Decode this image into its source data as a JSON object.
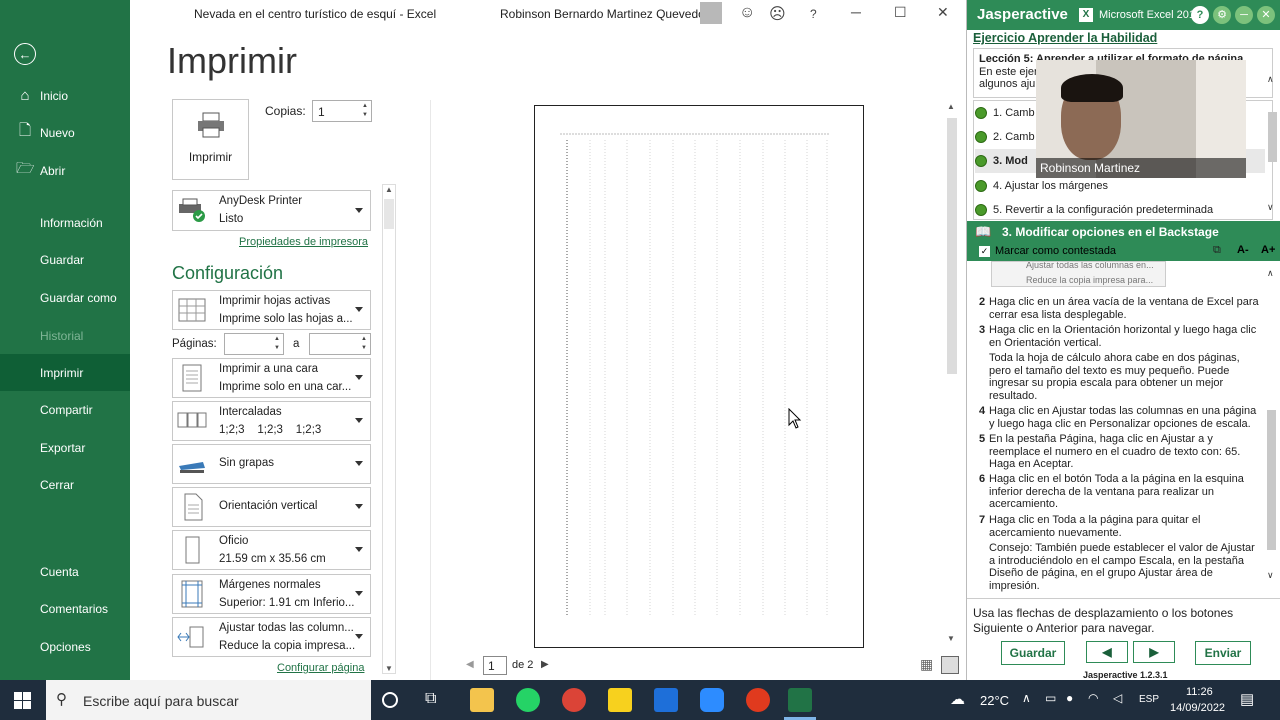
{
  "window": {
    "title": "Nevada en el centro turístico de esquí  -  Excel",
    "user": "Robinson Bernardo Martinez Quevedo",
    "help": "?"
  },
  "nav": {
    "items": [
      {
        "label": "Inicio",
        "icon": "home-icon"
      },
      {
        "label": "Nuevo",
        "icon": "new-file-icon"
      },
      {
        "label": "Abrir",
        "icon": "folder-open-icon"
      },
      {
        "label": "Información"
      },
      {
        "label": "Guardar"
      },
      {
        "label": "Guardar como"
      },
      {
        "label": "Historial"
      },
      {
        "label": "Imprimir"
      },
      {
        "label": "Compartir"
      },
      {
        "label": "Exportar"
      },
      {
        "label": "Cerrar"
      },
      {
        "label": "Cuenta"
      },
      {
        "label": "Comentarios"
      },
      {
        "label": "Opciones"
      }
    ]
  },
  "print": {
    "heading": "Imprimir",
    "print_button": "Imprimir",
    "copies_label": "Copias:",
    "copies_value": "1",
    "printer": {
      "name": "AnyDesk Printer",
      "status": "Listo"
    },
    "printer_props": "Propiedades de impresora",
    "config_heading": "Configuración",
    "pages_label": "Páginas:",
    "pages_to": "a",
    "options": [
      {
        "line1": "Imprimir hojas activas",
        "line2": "Imprime solo las hojas a..."
      },
      {
        "line1": "Imprimir a una cara",
        "line2": "Imprime solo en una car..."
      },
      {
        "line1": "Intercaladas",
        "line2": "1;2;3    1;2;3    1;2;3"
      },
      {
        "line1": "Sin grapas",
        "line2": ""
      },
      {
        "line1": "Orientación vertical",
        "line2": ""
      },
      {
        "line1": "Oficio",
        "line2": "21.59 cm x 35.56 cm"
      },
      {
        "line1": "Márgenes normales",
        "line2": "Superior: 1.91 cm Inferio..."
      },
      {
        "line1": "Ajustar todas las column...",
        "line2": "Reduce la copia impresa..."
      }
    ],
    "page_setup": "Configurar página"
  },
  "preview": {
    "current_page": "1",
    "of_pages": "de 2"
  },
  "jasper": {
    "brand": "Jasperactive",
    "app": "Microsoft Excel 2016",
    "exercise": "Ejercicio Aprender la Habilidad",
    "lesson_title": "Lección 5: Aprender a utilizar el formato de página",
    "lesson_desc_1": "En este ejer",
    "lesson_desc_2": "algunos aju",
    "lessons": [
      {
        "label": "1. Camb"
      },
      {
        "label": "2. Camb"
      },
      {
        "label": "3. Mod"
      },
      {
        "label": "4. Ajustar los márgenes"
      },
      {
        "label": "5. Revertir a la configuración predeterminada"
      }
    ],
    "webcam_name": "Robinson Martinez",
    "section_title": "3. Modificar opciones en el Backstage",
    "mark_answered": "Marcar como contestada",
    "font_down": "A-",
    "font_up": "A+",
    "thumb_line1": "Ajustar todas las columnas en...",
    "thumb_line2": "Reduce la copia impresa para...",
    "steps": [
      {
        "n": "2",
        "text": "Haga clic en un área vacía de la ventana de Excel para cerrar esa lista desplegable."
      },
      {
        "n": "3",
        "text": "Haga clic en la Orientación horizontal y luego haga clic en Orientación vertical."
      },
      {
        "n": "",
        "text": "Toda la hoja de cálculo ahora cabe en dos páginas, pero el tamaño del texto es muy pequeño. Puede ingresar su propia escala para obtener un mejor resultado."
      },
      {
        "n": "4",
        "text": "Haga clic en Ajustar todas las columnas en una página y luego haga clic en Personalizar opciones de escala."
      },
      {
        "n": "5",
        "text": "En la pestaña Página, haga clic en Ajustar a y reemplace el numero en el cuadro de texto con: 65. Haga en Aceptar."
      },
      {
        "n": "6",
        "text": "Haga clic en el botón Toda a la página en la esquina inferior derecha de la ventana para realizar un acercamiento."
      },
      {
        "n": "7",
        "text": "Haga clic en Toda a la página para quitar el acercamiento nuevamente."
      },
      {
        "n": "",
        "text": "Consejo: También puede establecer el valor de Ajustar a introduciéndolo en el campo Escala, en la pestaña Diseño de página, en el grupo Ajustar área de impresión."
      }
    ],
    "nav_hint": "Usa las flechas de desplazamiento o los botones Siguiente o Anterior para navegar.",
    "save": "Guardar",
    "send": "Enviar",
    "version": "Jasperactive 1.2.3.1"
  },
  "taskbar": {
    "search": "Escribe aquí para buscar",
    "temp": "22°C",
    "lang": "ESP",
    "time": "11:26",
    "date": "14/09/2022"
  },
  "colors": {
    "excel_green": "#217346",
    "nav_active": "#0f5f36",
    "jasper_green": "#2e8b57"
  }
}
